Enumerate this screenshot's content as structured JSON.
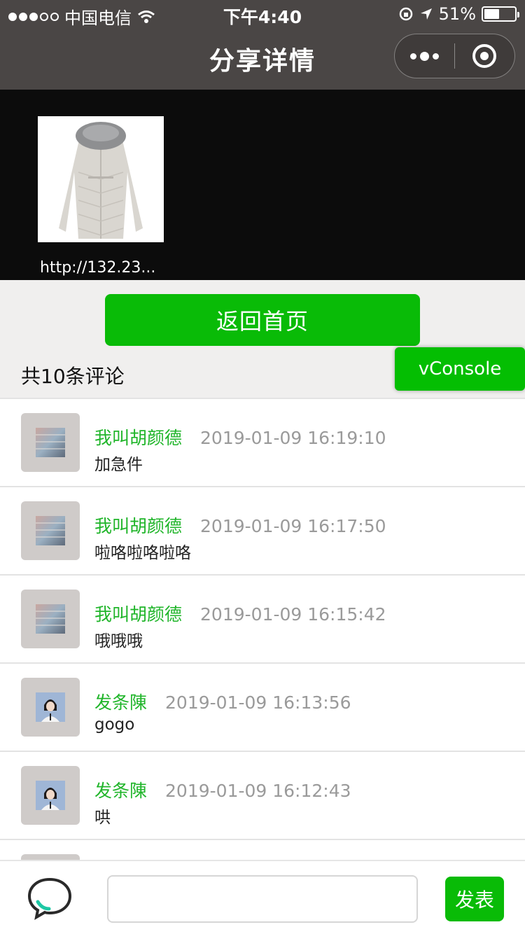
{
  "status_bar": {
    "carrier": "中国电信",
    "time": "下午4:40",
    "battery": "51%",
    "battery_level": 0.51
  },
  "nav": {
    "title": "分享详情",
    "more_icon": "ellipsis-icon",
    "close_icon": "record-circle-icon"
  },
  "share": {
    "image_alt": "long down coat with fur hood",
    "link_text": "http://132.23..."
  },
  "home_button_label": "返回首页",
  "comments": {
    "count_label": "共10条评论",
    "items": [
      {
        "name": "我叫胡颜德",
        "time": "2019-01-09 16:19:10",
        "text": "加急件",
        "avatar": "gradient"
      },
      {
        "name": "我叫胡颜德",
        "time": "2019-01-09 16:17:50",
        "text": "啦咯啦咯啦咯",
        "avatar": "gradient"
      },
      {
        "name": "我叫胡颜德",
        "time": "2019-01-09 16:15:42",
        "text": "哦哦哦",
        "avatar": "gradient"
      },
      {
        "name": "发条陳",
        "time": "2019-01-09 16:13:56",
        "text": "gogo",
        "avatar": "portrait"
      },
      {
        "name": "发条陳",
        "time": "2019-01-09 16:12:43",
        "text": "哄",
        "avatar": "portrait"
      }
    ]
  },
  "vconsole_label": "vConsole",
  "composer": {
    "input_value": "",
    "send_label": "发表",
    "icon": "chat-bubble-icon"
  },
  "colors": {
    "brand_green": "#09bb07",
    "name_green": "#20b52a",
    "nav_bg": "#4a4645"
  }
}
